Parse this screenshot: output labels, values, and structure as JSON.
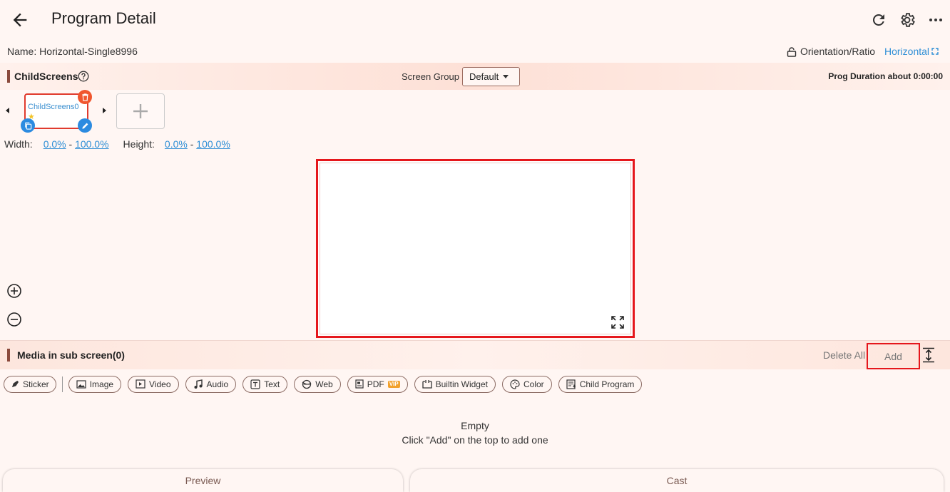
{
  "header": {
    "title": "Program Detail"
  },
  "program": {
    "name_label": "Name: Horizontal-Single8996",
    "orientation_label": "Orientation/Ratio",
    "orientation_value": "Horizontal"
  },
  "childscreens": {
    "title": "ChildScreens",
    "screen_group_label": "Screen Group",
    "screen_group_value": "Default",
    "duration": "Prog Duration about 0:00:00",
    "items": [
      {
        "label": "ChildScreens0",
        "star": "★"
      }
    ],
    "width_label": "Width:",
    "width_from": "0.0%",
    "width_to": "100.0%",
    "height_label": "Height:",
    "height_from": "0.0%",
    "height_to": "100.0%",
    "range_sep": " - "
  },
  "media": {
    "title": "Media in sub screen(0)",
    "delete_all": "Delete All",
    "add": "Add",
    "types": [
      {
        "label": "Sticker",
        "icon": "sticker-icon"
      },
      {
        "label": "Image",
        "icon": "image-icon"
      },
      {
        "label": "Video",
        "icon": "video-icon"
      },
      {
        "label": "Audio",
        "icon": "music-note-icon"
      },
      {
        "label": "Text",
        "icon": "text-icon"
      },
      {
        "label": "Web",
        "icon": "web-icon"
      },
      {
        "label": "PDF",
        "icon": "pdf-icon",
        "badge": "VIP"
      },
      {
        "label": "Builtin Widget",
        "icon": "widget-icon"
      },
      {
        "label": "Color",
        "icon": "palette-icon"
      },
      {
        "label": "Child Program",
        "icon": "child-program-icon"
      }
    ],
    "empty_title": "Empty",
    "empty_hint": "Click \"Add\" on the top to add one"
  },
  "footer": {
    "preview": "Preview",
    "cast": "Cast"
  },
  "colors": {
    "accent": "#2f8fd6",
    "highlight": "#e5171c",
    "delete": "#f0562e",
    "section_bar": "#8b4a3c"
  }
}
